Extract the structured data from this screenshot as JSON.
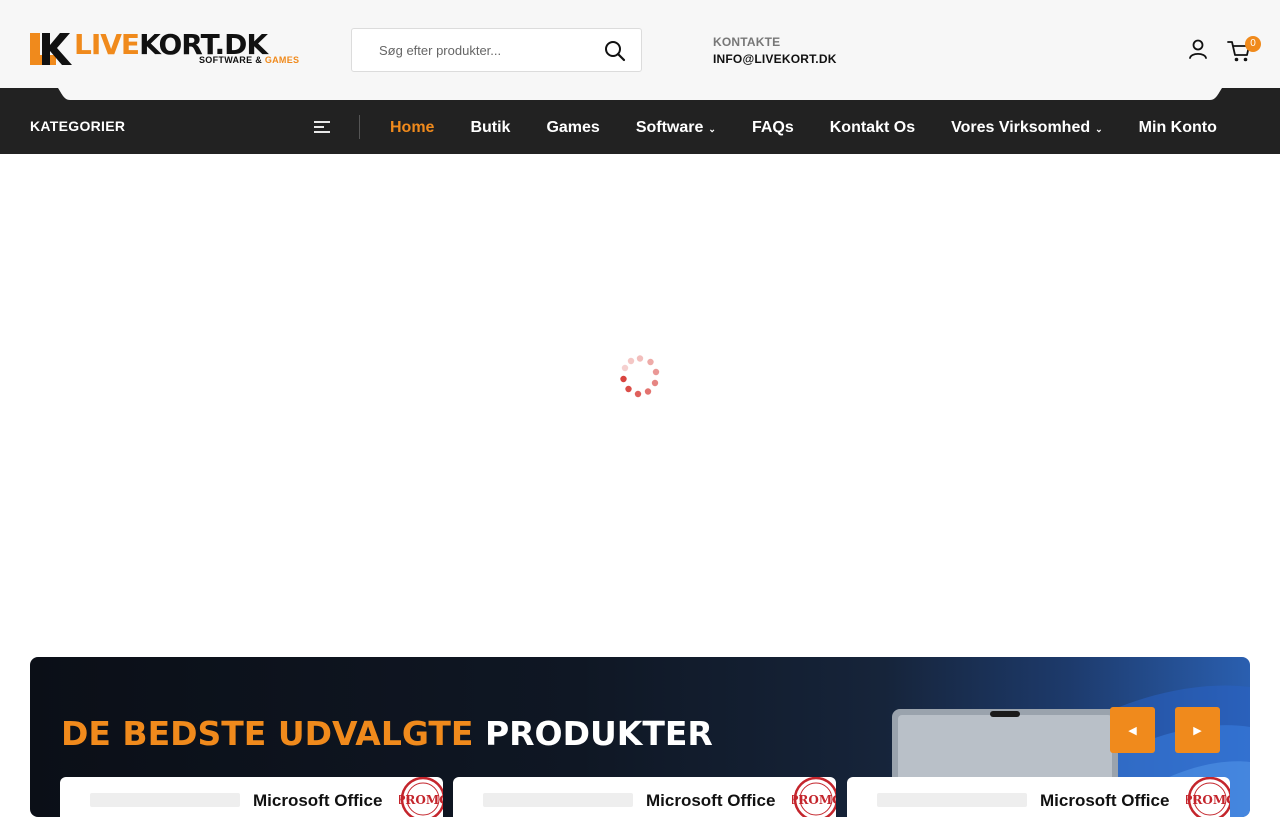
{
  "logo": {
    "part1": "LIVE",
    "part2": "KORT.DK",
    "tag_a": "SOFTWARE & ",
    "tag_b": "GAMES"
  },
  "search": {
    "placeholder": "Søg efter produkter..."
  },
  "contact": {
    "label": "KONTAKTE",
    "email": "INFO@LIVEKORT.DK"
  },
  "cart": {
    "count": "0"
  },
  "nav": {
    "categories_label": "KATEGORIER",
    "items": [
      {
        "label": "Home"
      },
      {
        "label": "Butik"
      },
      {
        "label": "Games"
      },
      {
        "label": "Software"
      },
      {
        "label": "FAQs"
      },
      {
        "label": "Kontakt Os"
      },
      {
        "label": "Vores Virksomhed"
      },
      {
        "label": "Min Konto"
      }
    ]
  },
  "banner": {
    "title_a": "DE BEDSTE UDVALGTE ",
    "title_b": "PRODUKTER",
    "cards": [
      {
        "title": "Microsoft Office",
        "badge": "PROMO"
      },
      {
        "title": "Microsoft Office",
        "badge": "PROMO"
      },
      {
        "title": "Microsoft Office",
        "badge": "PROMO"
      }
    ]
  },
  "colors": {
    "accent": "#f08a1c",
    "nav_bg": "#222222",
    "loader": "#d9443f"
  },
  "icons": {
    "search": "search-icon",
    "user": "user-icon",
    "cart": "cart-icon",
    "menu": "menu-icon"
  }
}
